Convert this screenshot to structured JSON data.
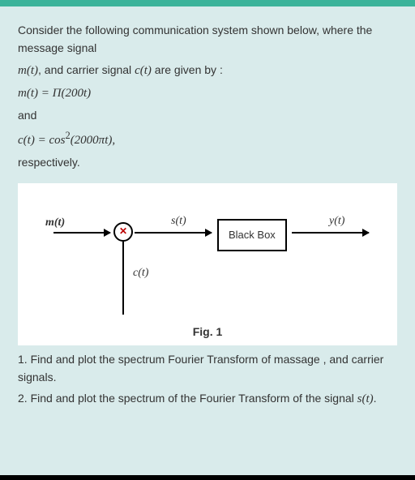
{
  "intro": {
    "line1": "Consider the following communication system shown below, where the message signal",
    "line2_pre": "m(t)",
    "line2_mid": ", and carrier signal ",
    "line2_c": "c(t)",
    "line2_end": " are given by :"
  },
  "eqs": {
    "mt": "m(t) = Π(200t)",
    "and": "and",
    "ct_pre": "c(t) = cos",
    "ct_exp": "2",
    "ct_post": "(2000πt),",
    "resp": "respectively."
  },
  "diagram": {
    "mt": "m(t)",
    "st": "s(t)",
    "yt": "y(t)",
    "ct": "c(t)",
    "box": "Black Box",
    "mixer": "✕",
    "caption": "Fig. 1"
  },
  "q1": "1. Find and plot the spectrum Fourier Transform of massage , and carrier signals.",
  "q2_pre": "2. Find and plot the spectrum of the Fourier Transform of the signal ",
  "q2_sig": "s(t)",
  "q2_end": "."
}
